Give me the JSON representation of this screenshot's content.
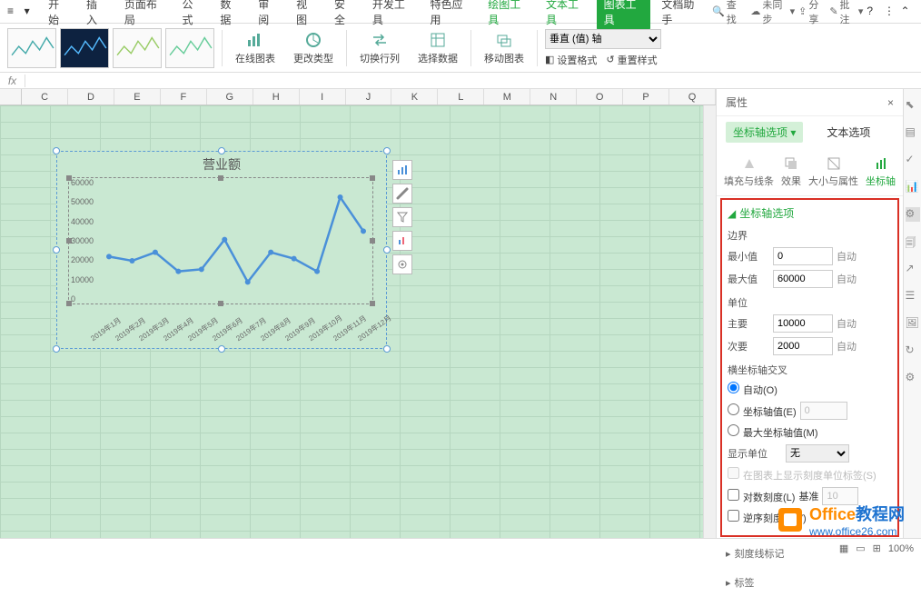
{
  "ribbon": {
    "tabs": [
      "开始",
      "插入",
      "页面布局",
      "公式",
      "数据",
      "审阅",
      "视图",
      "安全",
      "开发工具",
      "特色应用",
      "绘图工具",
      "文本工具"
    ],
    "active_tab": "图表工具",
    "helper": "文档助手",
    "search": "查找",
    "sync": "未同步",
    "share": "分享",
    "comment": "批注"
  },
  "toolbar": {
    "online_chart": "在线图表",
    "change_type": "更改类型",
    "switch_rc": "切换行列",
    "select_data": "选择数据",
    "move_chart": "移动图表",
    "axis_select_value": "垂直 (值) 轴",
    "set_format": "设置格式",
    "reset_style": "重置样式"
  },
  "columns": [
    "",
    "C",
    "D",
    "E",
    "F",
    "G",
    "H",
    "I",
    "J",
    "K",
    "L",
    "M",
    "N",
    "O",
    "P",
    "Q"
  ],
  "chart_data": {
    "type": "line",
    "title": "营业额",
    "categories": [
      "2019年1月",
      "2019年2月",
      "2019年3月",
      "2019年4月",
      "2019年5月",
      "2019年6月",
      "2019年7月",
      "2019年8月",
      "2019年9月",
      "2019年10月",
      "2019年11月",
      "2019年12月"
    ],
    "values": [
      23000,
      21000,
      25000,
      16000,
      17000,
      31000,
      11000,
      25000,
      22000,
      16000,
      51000,
      35000
    ],
    "ylim": [
      0,
      60000
    ],
    "y_ticks": [
      0,
      10000,
      20000,
      30000,
      40000,
      50000,
      60000
    ]
  },
  "props": {
    "panel_title": "属性",
    "tab_axis": "坐标轴选项",
    "tab_text": "文本选项",
    "icons": {
      "fill": "填充与线条",
      "effect": "效果",
      "size": "大小与属性",
      "axis": "坐标轴"
    },
    "section": "坐标轴选项",
    "bounds": "边界",
    "min_label": "最小值",
    "min_val": "0",
    "min_auto": "自动",
    "max_label": "最大值",
    "max_val": "60000",
    "max_auto": "自动",
    "units": "单位",
    "major_label": "主要",
    "major_val": "10000",
    "major_auto": "自动",
    "minor_label": "次要",
    "minor_val": "2000",
    "minor_auto": "自动",
    "cross": "横坐标轴交叉",
    "auto_o": "自动(O)",
    "axis_val_e": "坐标轴值(E)",
    "axis_val_e_val": "0",
    "max_axis_m": "最大坐标轴值(M)",
    "display_unit": "显示单位",
    "display_unit_val": "无",
    "show_unit_label": "在图表上显示刻度单位标签(S)",
    "log_scale": "对数刻度(L)",
    "base_label": "基准",
    "base_val": "10",
    "reverse": "逆序刻度值(V)",
    "tickmark": "刻度线标记",
    "labels": "标签"
  },
  "watermark": {
    "brand": "Office",
    "suffix": "教程网",
    "url": "www.office26.com"
  },
  "zoom": "100%"
}
